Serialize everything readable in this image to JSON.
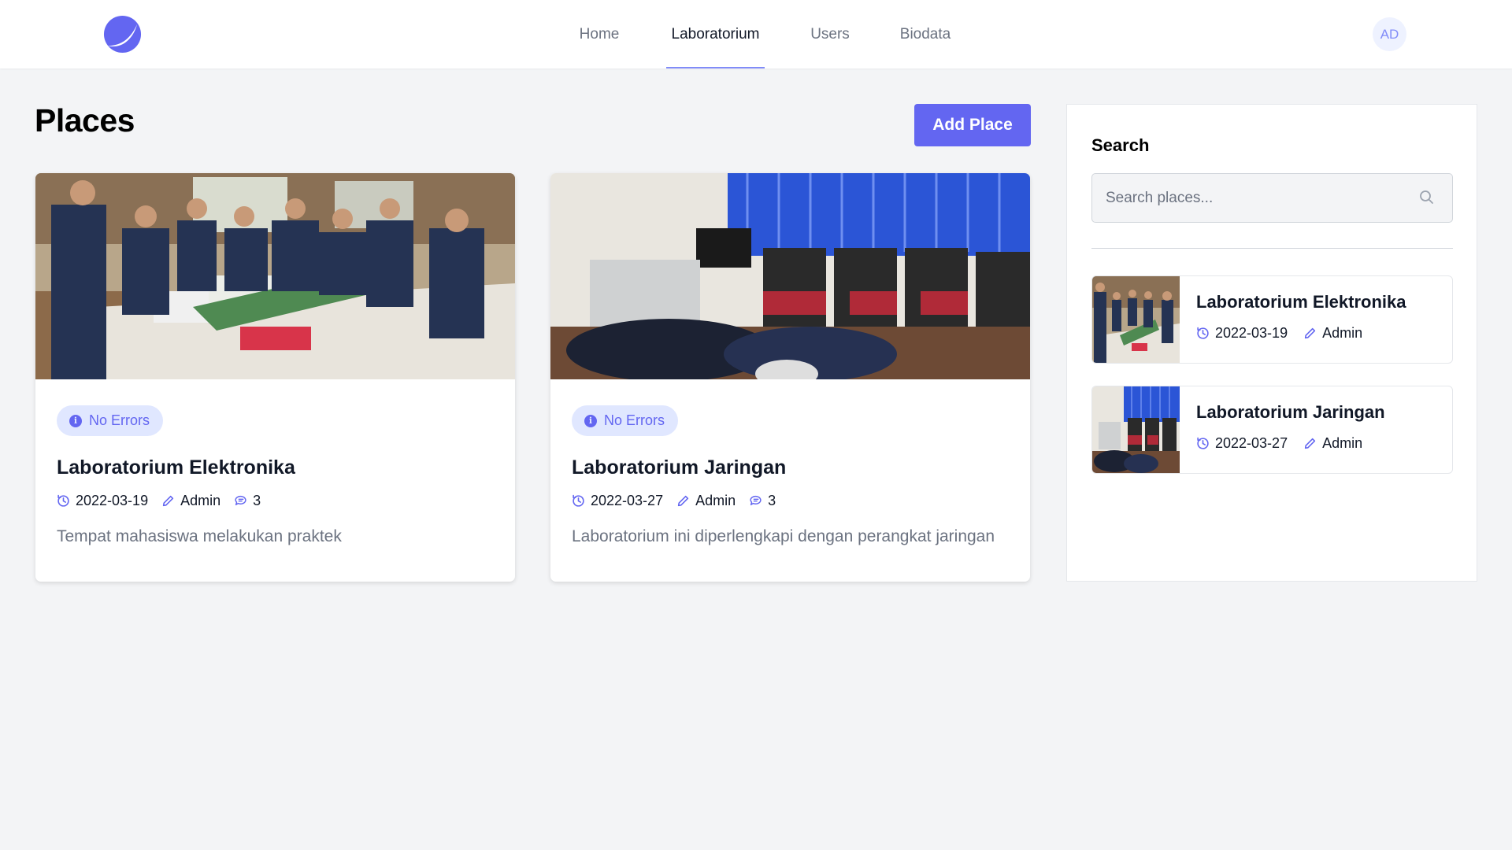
{
  "nav": {
    "links": [
      {
        "label": "Home"
      },
      {
        "label": "Laboratorium"
      },
      {
        "label": "Users"
      },
      {
        "label": "Biodata"
      }
    ],
    "active": "Laboratorium",
    "avatar_initials": "AD"
  },
  "header": {
    "title": "Places",
    "add_button_label": "Add Place"
  },
  "cards": [
    {
      "badge": "No Errors",
      "title": "Laboratorium Elektronika",
      "date": "2022-03-19",
      "author": "Admin",
      "comments": "3",
      "description": "Tempat mahasiswa melakukan praktek"
    },
    {
      "badge": "No Errors",
      "title": "Laboratorium Jaringan",
      "date": "2022-03-27",
      "author": "Admin",
      "comments": "3",
      "description": "Laboratorium ini diperlengkapi dengan perangkat jaringan"
    }
  ],
  "sidebar": {
    "title": "Search",
    "search_placeholder": "Search places...",
    "items": [
      {
        "title": "Laboratorium Elektronika",
        "date": "2022-03-19",
        "author": "Admin"
      },
      {
        "title": "Laboratorium Jaringan",
        "date": "2022-03-27",
        "author": "Admin"
      }
    ]
  },
  "colors": {
    "accent": "#6366f1",
    "badge_bg": "#e0e7ff",
    "page_bg": "#f3f4f6"
  }
}
